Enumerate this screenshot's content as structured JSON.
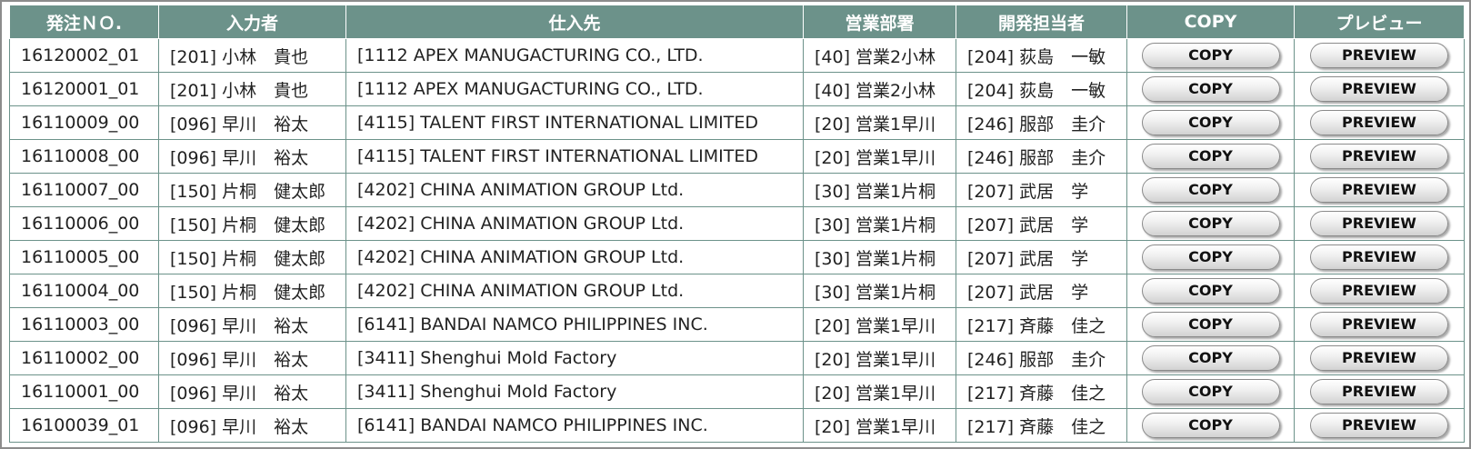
{
  "columns": [
    "発注ＮＯ.",
    "入力者",
    "仕入先",
    "営業部署",
    "開発担当者",
    "COPY",
    "プレビュー"
  ],
  "button_labels": {
    "copy": "COPY",
    "preview": "PREVIEW"
  },
  "colors": {
    "header_bg": "#6c928a",
    "border": "#6c928a"
  },
  "rows": [
    {
      "order_no": "16120002_01",
      "entered_by": "[201] 小林　貴也",
      "supplier": "[1112 APEX MANUGACTURING CO., LTD.",
      "sales_dept": "[40] 営業2小林",
      "developer": "[204] 荻島　一敏"
    },
    {
      "order_no": "16120001_01",
      "entered_by": "[201] 小林　貴也",
      "supplier": "[1112 APEX MANUGACTURING CO., LTD.",
      "sales_dept": "[40] 営業2小林",
      "developer": "[204] 荻島　一敏"
    },
    {
      "order_no": "16110009_00",
      "entered_by": "[096] 早川　裕太",
      "supplier": "[4115] TALENT FIRST INTERNATIONAL LIMITED",
      "sales_dept": "[20] 営業1早川",
      "developer": "[246] 服部　圭介"
    },
    {
      "order_no": "16110008_00",
      "entered_by": "[096] 早川　裕太",
      "supplier": "[4115] TALENT FIRST INTERNATIONAL LIMITED",
      "sales_dept": "[20] 営業1早川",
      "developer": "[246] 服部　圭介"
    },
    {
      "order_no": "16110007_00",
      "entered_by": "[150] 片桐　健太郎",
      "supplier": "[4202] CHINA ANIMATION GROUP Ltd.",
      "sales_dept": "[30] 営業1片桐",
      "developer": "[207] 武居　学"
    },
    {
      "order_no": "16110006_00",
      "entered_by": "[150] 片桐　健太郎",
      "supplier": "[4202] CHINA ANIMATION GROUP Ltd.",
      "sales_dept": "[30] 営業1片桐",
      "developer": "[207] 武居　学"
    },
    {
      "order_no": "16110005_00",
      "entered_by": "[150] 片桐　健太郎",
      "supplier": "[4202] CHINA ANIMATION GROUP Ltd.",
      "sales_dept": "[30] 営業1片桐",
      "developer": "[207] 武居　学"
    },
    {
      "order_no": "16110004_00",
      "entered_by": "[150] 片桐　健太郎",
      "supplier": "[4202] CHINA ANIMATION GROUP Ltd.",
      "sales_dept": "[30] 営業1片桐",
      "developer": "[207] 武居　学"
    },
    {
      "order_no": "16110003_00",
      "entered_by": "[096] 早川　裕太",
      "supplier": "[6141] BANDAI NAMCO PHILIPPINES INC.",
      "sales_dept": "[20] 営業1早川",
      "developer": "[217] 斉藤　佳之"
    },
    {
      "order_no": "16110002_00",
      "entered_by": "[096] 早川　裕太",
      "supplier": "[3411] Shenghui Mold Factory",
      "sales_dept": "[20] 営業1早川",
      "developer": "[246] 服部　圭介"
    },
    {
      "order_no": "16110001_00",
      "entered_by": "[096] 早川　裕太",
      "supplier": "[3411] Shenghui Mold Factory",
      "sales_dept": "[20] 営業1早川",
      "developer": "[217] 斉藤　佳之"
    },
    {
      "order_no": "16100039_01",
      "entered_by": "[096] 早川　裕太",
      "supplier": "[6141] BANDAI NAMCO PHILIPPINES INC.",
      "sales_dept": "[20] 営業1早川",
      "developer": "[217] 斉藤　佳之"
    }
  ]
}
